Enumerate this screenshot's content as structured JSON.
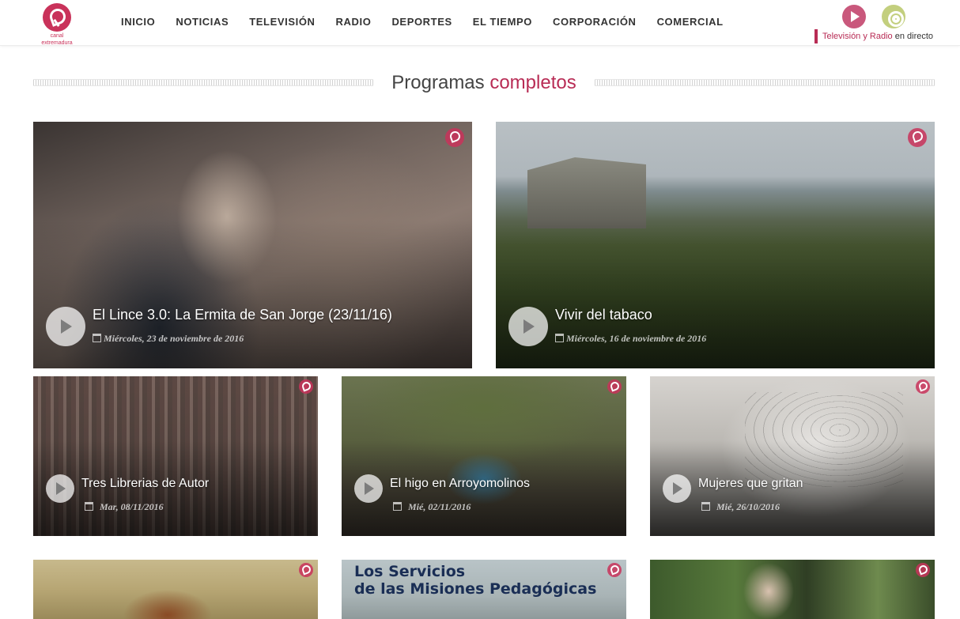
{
  "header": {
    "logo_text_line1": "canal",
    "logo_text_line2": "extremadura",
    "nav": [
      "INICIO",
      "NOTICIAS",
      "TELEVISIÓN",
      "RADIO",
      "DEPORTES",
      "EL TIEMPO",
      "CORPORACIÓN",
      "COMERCIAL"
    ],
    "live": {
      "label_accent": "Televisión y Radio",
      "label_rest": " en directo",
      "tv_icon": "play-circle-icon",
      "radio_icon": "radio-target-icon"
    }
  },
  "section": {
    "title_part1": "Programas ",
    "title_part2": "completos"
  },
  "programs": [
    {
      "title": "El Lince 3.0: La Ermita de San Jorge (23/11/16)",
      "date": "Miércoles, 23 de noviembre de 2016"
    },
    {
      "title": "Vivir del tabaco",
      "date": "Miércoles, 16 de noviembre de 2016"
    },
    {
      "title": "Tres Librerias de Autor",
      "date": "Mar, 08/11/2016"
    },
    {
      "title": "El higo en Arroyomolinos",
      "date": "Mié, 02/11/2016"
    },
    {
      "title": "Mujeres que gritan",
      "date": "Mié, 26/10/2016"
    }
  ],
  "partial_cards": [
    {
      "poster_line1": "Los Servicios",
      "poster_line2": "de las Misiones Pedagógicas"
    }
  ],
  "colors": {
    "brand": "#b82c55",
    "live_tv": "#c9587c",
    "live_radio": "#c3cf7e"
  }
}
